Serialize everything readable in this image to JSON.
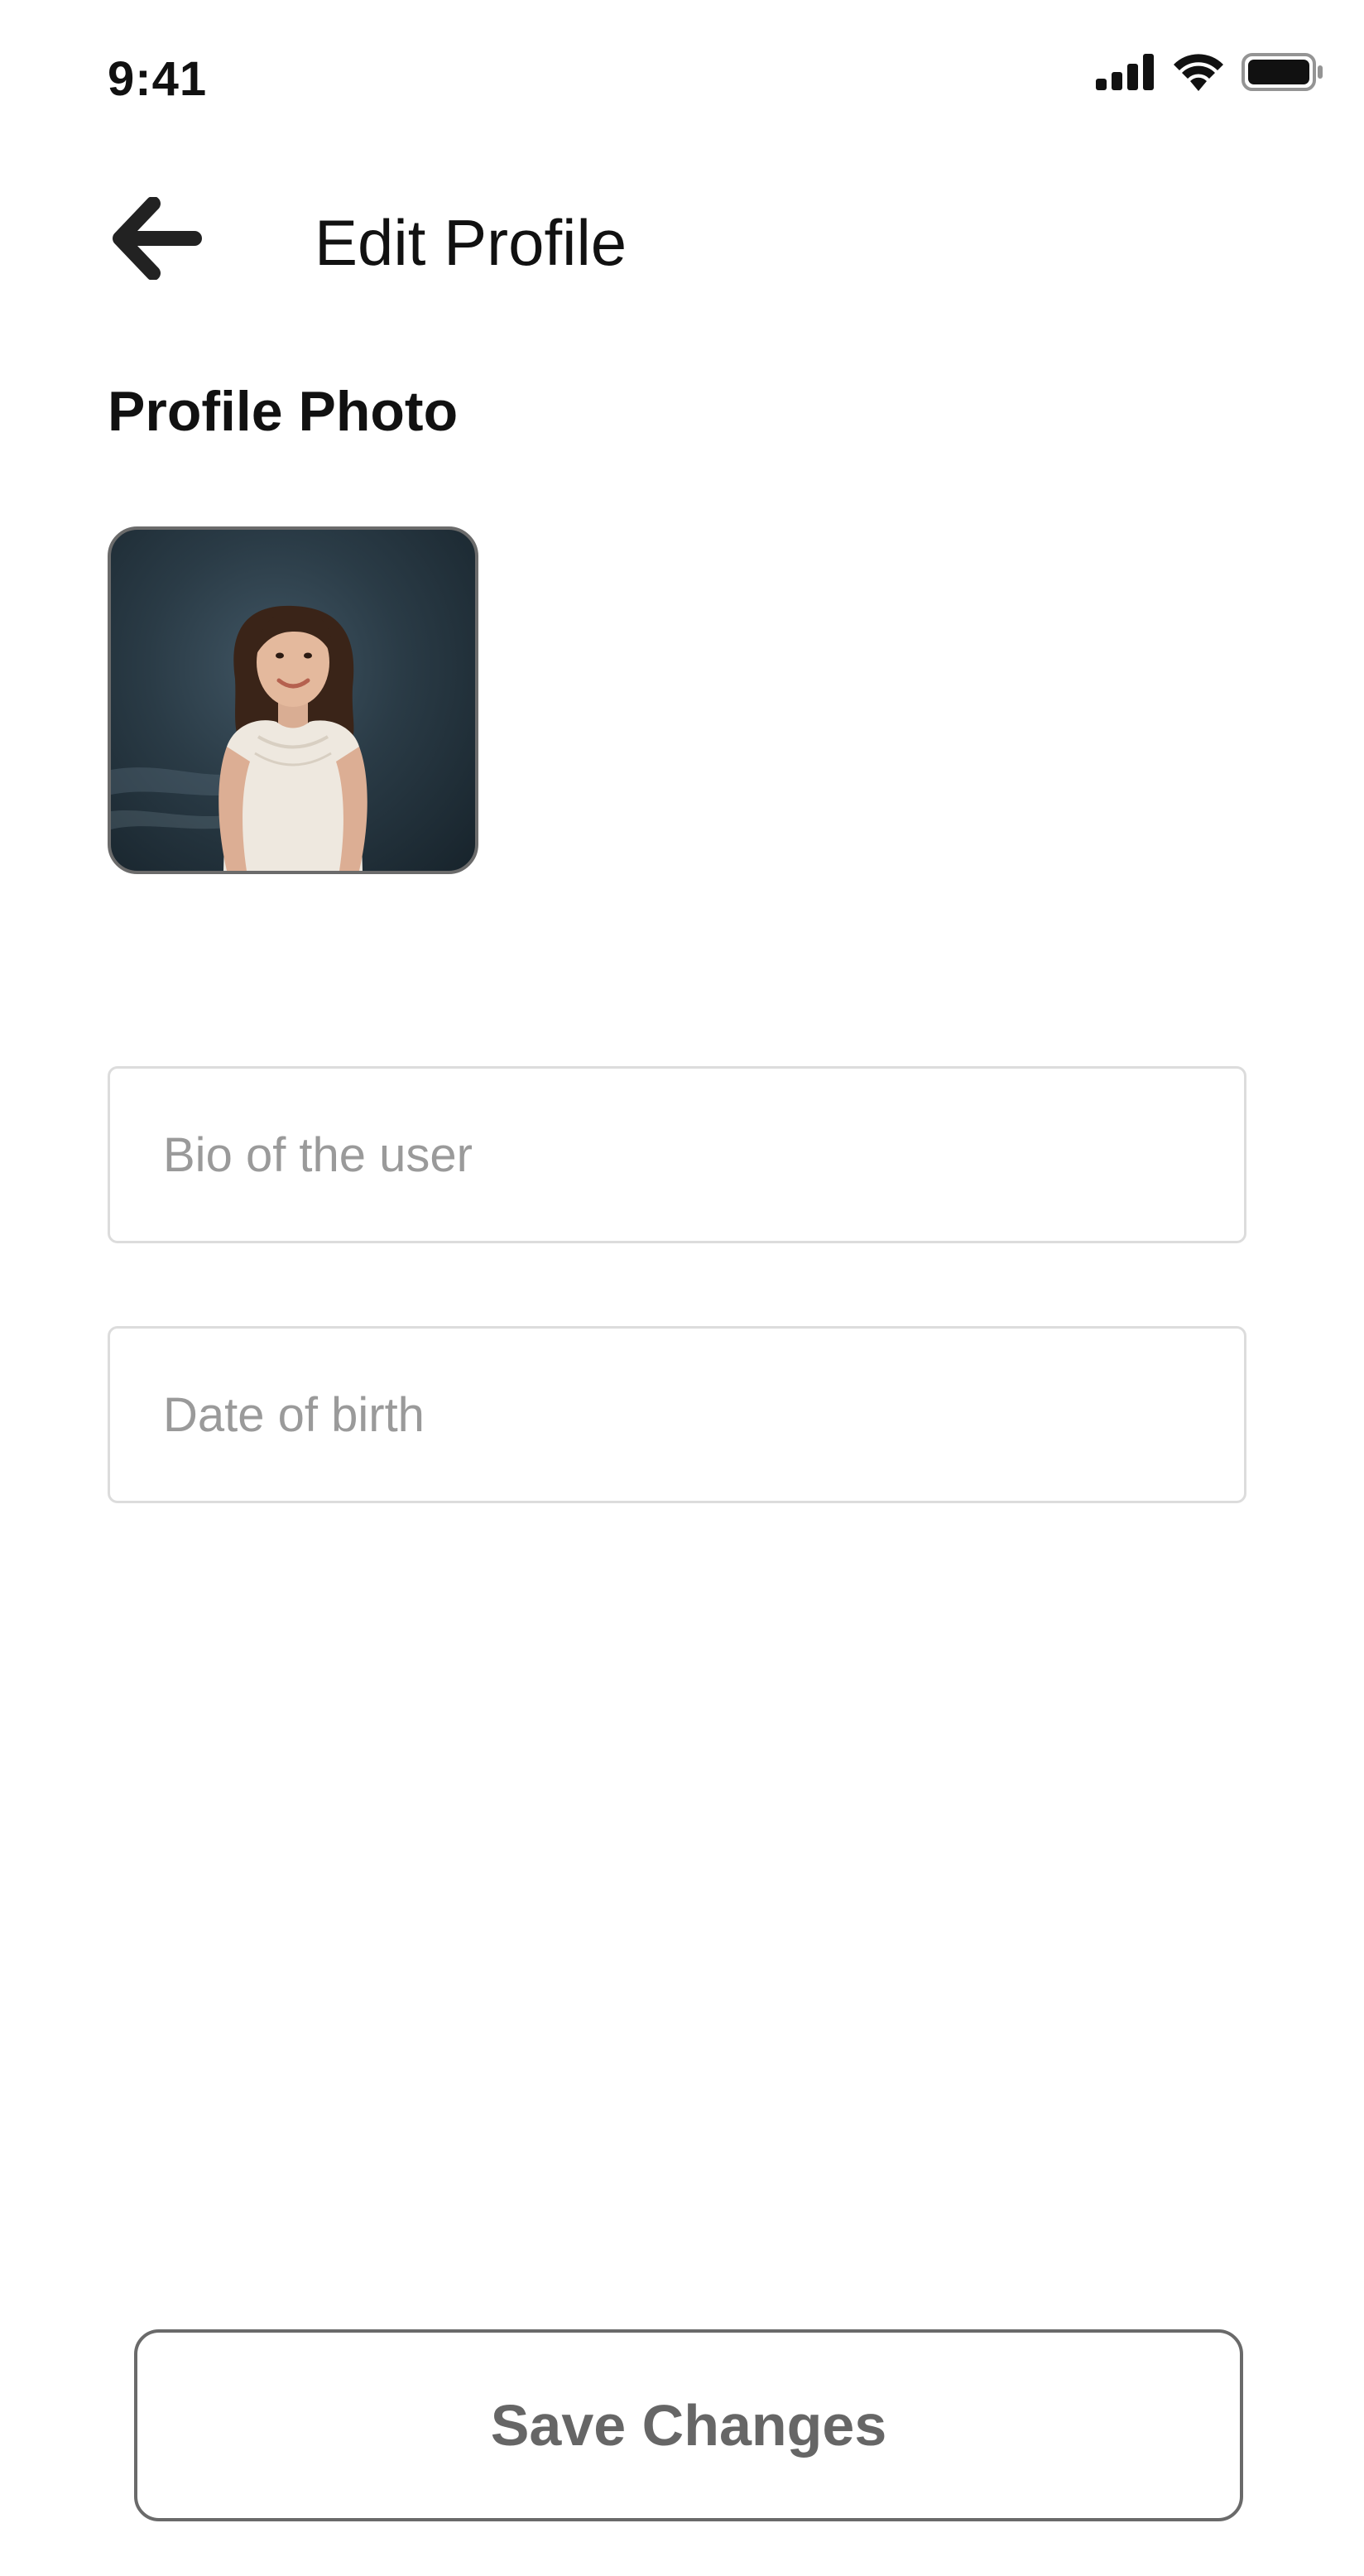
{
  "status_bar": {
    "time": "9:41",
    "icons": [
      "cellular-signal-icon",
      "wifi-icon",
      "battery-icon"
    ]
  },
  "header": {
    "back_icon": "arrow-left-icon",
    "title": "Edit Profile"
  },
  "profile_photo": {
    "section_title": "Profile Photo"
  },
  "form": {
    "bio": {
      "placeholder": "Bio of the user",
      "value": ""
    },
    "date_of_birth": {
      "placeholder": "Date of birth",
      "value": ""
    }
  },
  "actions": {
    "save_label": "Save Changes"
  },
  "colors": {
    "text_primary": "#111111",
    "placeholder": "#9a9a9a",
    "field_border": "#dcdcdc",
    "button_border": "#6a6a6a",
    "button_text": "#666666"
  }
}
